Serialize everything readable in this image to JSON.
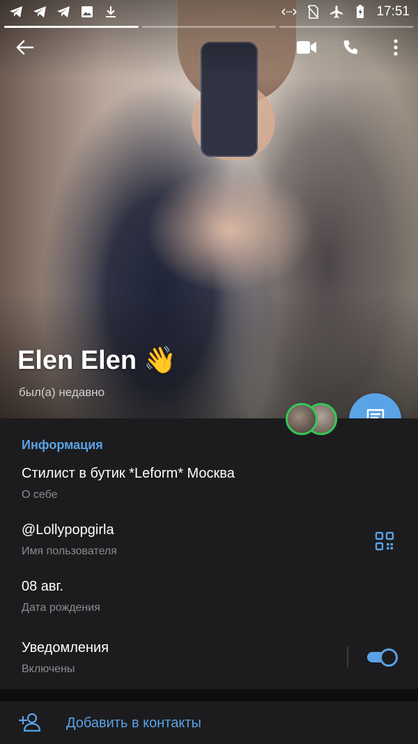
{
  "status_bar": {
    "time": "17:51",
    "left_icons": [
      "telegram-icon",
      "telegram-icon",
      "telegram-icon",
      "image-icon",
      "download-icon"
    ],
    "right_icons": [
      "nfc-icon",
      "no-sim-icon",
      "airplane-icon",
      "battery-icon"
    ]
  },
  "story_progress": {
    "count": 3,
    "active_index": 0
  },
  "toolbar": {
    "back_icon": "arrow-left-icon",
    "video_icon": "video-call-icon",
    "call_icon": "phone-icon",
    "menu_icon": "more-vertical-icon"
  },
  "profile": {
    "name": "Elen Elen",
    "emoji": "👋",
    "last_seen": "был(а) недавно"
  },
  "info": {
    "section_title": "Информация",
    "bio_value": "Стилист в бутик *Leform* Москва",
    "bio_label": "О себе",
    "username_value": "@Lollypopgirla",
    "username_label": "Имя пользователя",
    "birthday_value": "08 авг.",
    "birthday_label": "Дата рождения",
    "notifications_value": "Уведомления",
    "notifications_label": "Включены",
    "notifications_enabled": true
  },
  "actions": {
    "add_contact": "Добавить в контакты"
  },
  "colors": {
    "accent": "#5aa3e6",
    "background": "#1c1c1e",
    "story_ring": "#35c759"
  }
}
